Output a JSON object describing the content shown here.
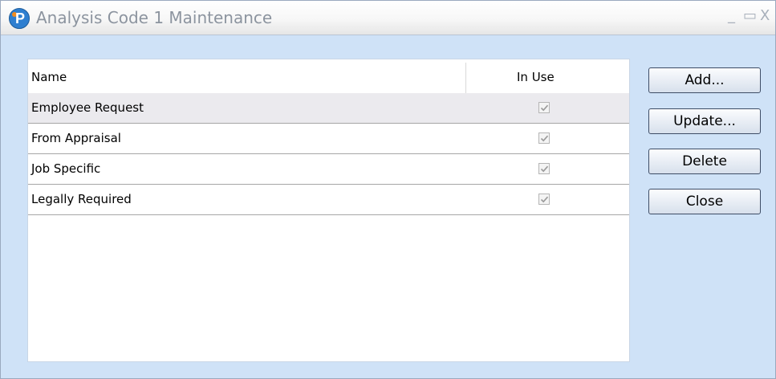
{
  "window": {
    "title": "Analysis Code 1 Maintenance",
    "controls": {
      "minimize": "_",
      "maximize": "▭",
      "close": "X"
    }
  },
  "list": {
    "columns": {
      "name": "Name",
      "in_use": "In Use"
    },
    "rows": [
      {
        "name": "Employee Request",
        "in_use": true,
        "selected": true
      },
      {
        "name": "From Appraisal",
        "in_use": true,
        "selected": false
      },
      {
        "name": "Job Specific",
        "in_use": true,
        "selected": false
      },
      {
        "name": "Legally Required",
        "in_use": true,
        "selected": false
      }
    ]
  },
  "buttons": {
    "add": "Add...",
    "update": "Update...",
    "delete": "Delete",
    "close": "Close"
  },
  "icons": {
    "app": "app-logo-icon",
    "checkbox": "checkmark-icon"
  },
  "colors": {
    "window_bg": "#cfe2f7",
    "accent": "#2f7fd0",
    "selected_row": "#ebeaee"
  }
}
